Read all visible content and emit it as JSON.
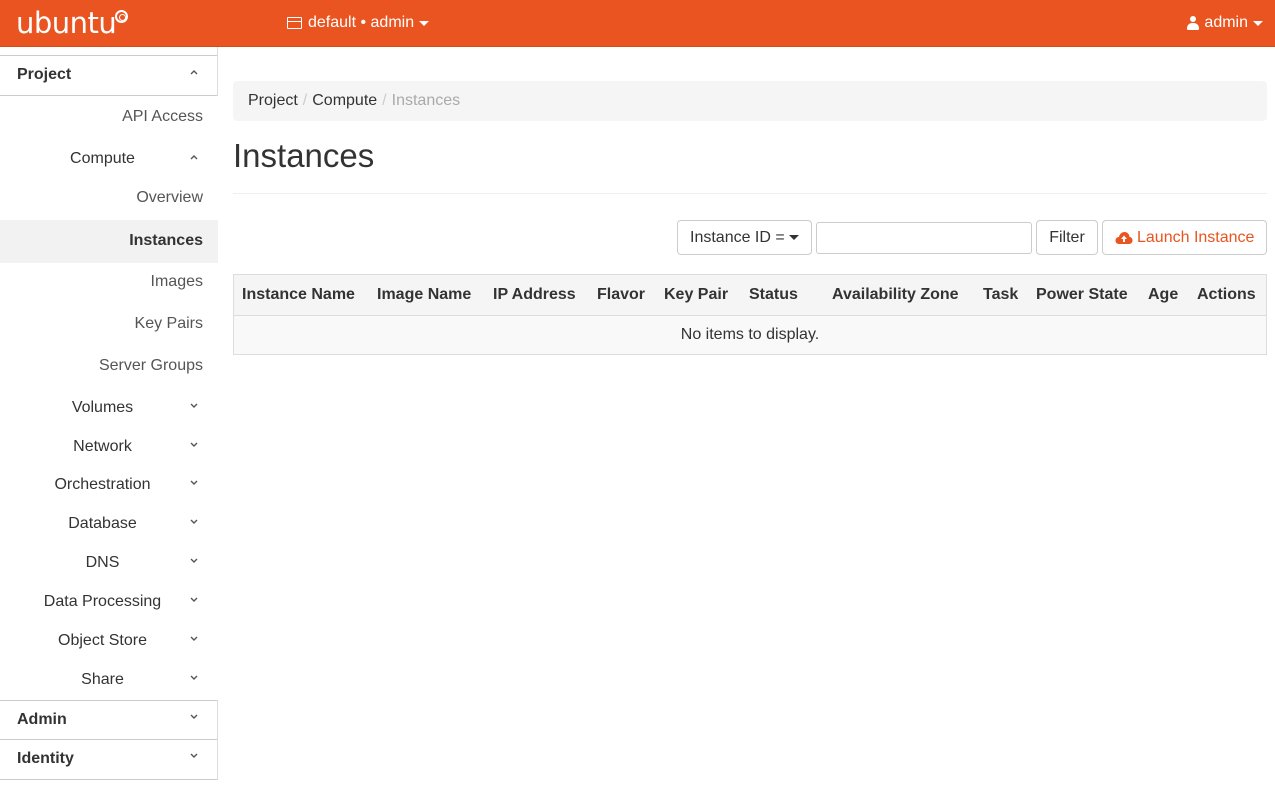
{
  "topbar": {
    "brand": "ubuntu",
    "project_label": "default • admin",
    "user_label": "admin"
  },
  "sidebar": {
    "project_header": "Project",
    "api_access": "API Access",
    "compute_group": "Compute",
    "compute_items": [
      "Overview",
      "Instances",
      "Images",
      "Key Pairs",
      "Server Groups"
    ],
    "active_item": "Instances",
    "groups": [
      "Volumes",
      "Network",
      "Orchestration",
      "Database",
      "DNS",
      "Data Processing",
      "Object Store",
      "Share"
    ],
    "admin_header": "Admin",
    "identity_header": "Identity"
  },
  "breadcrumb": [
    "Project",
    "Compute",
    "Instances"
  ],
  "page_title": "Instances",
  "filter": {
    "field_label": "Instance ID =",
    "input_value": "",
    "filter_button": "Filter",
    "launch_button": "Launch Instance"
  },
  "table": {
    "columns": [
      "Instance Name",
      "Image Name",
      "IP Address",
      "Flavor",
      "Key Pair",
      "Status",
      "Availability Zone",
      "Task",
      "Power State",
      "Age",
      "Actions"
    ],
    "empty_message": "No items to display."
  },
  "colors": {
    "brand_orange": "#e95420"
  }
}
